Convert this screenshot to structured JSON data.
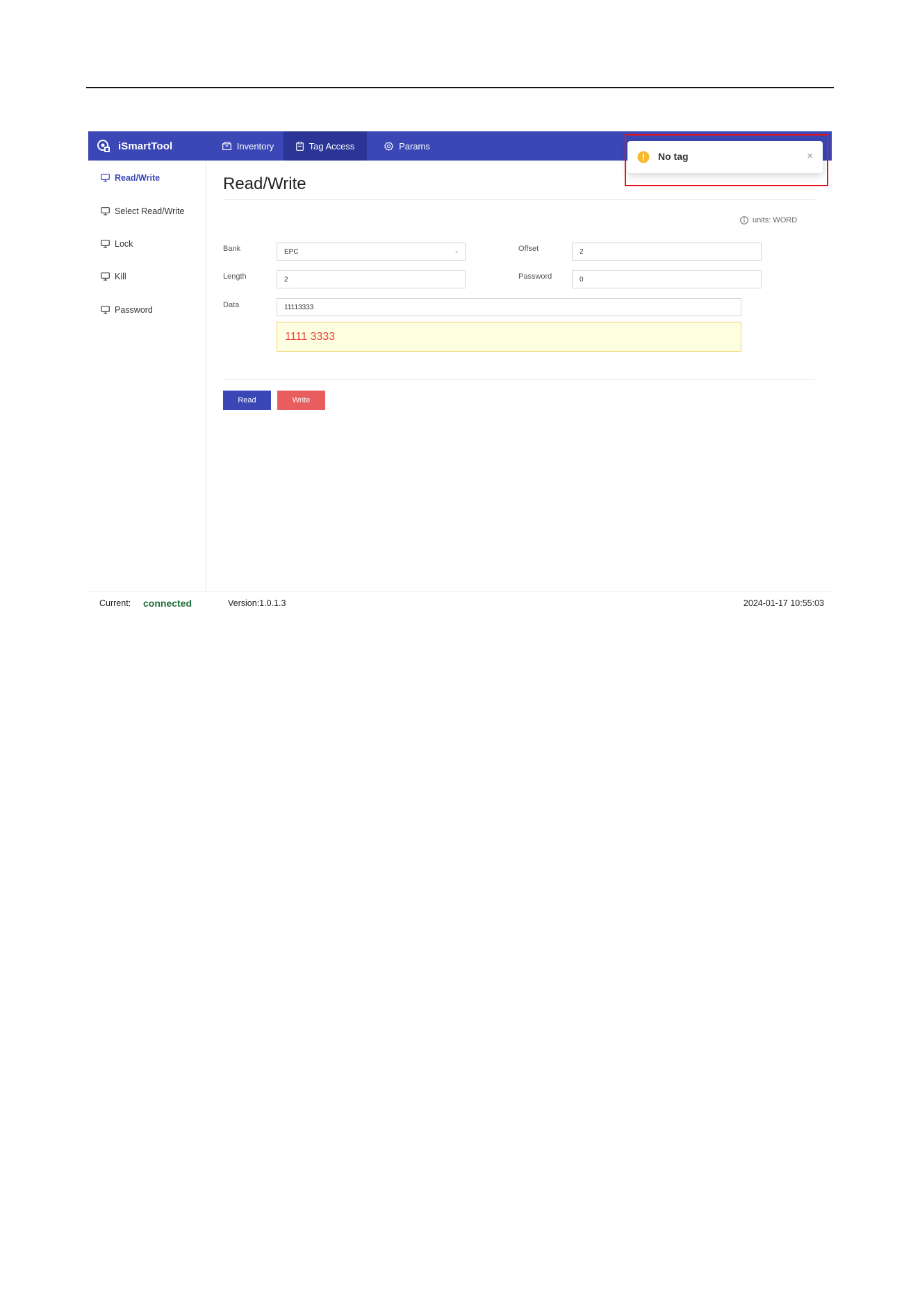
{
  "app": {
    "brand": "iSmartTool",
    "nav": [
      {
        "label": "Inventory",
        "icon": "box-icon",
        "active": false
      },
      {
        "label": "Tag Access",
        "icon": "clipboard-icon",
        "active": true
      },
      {
        "label": "Params",
        "icon": "gear-icon",
        "active": false
      }
    ]
  },
  "sidebar": {
    "items": [
      {
        "label": "Read/Write",
        "icon": "monitor-icon",
        "active": true
      },
      {
        "label": "Select Read/Write",
        "icon": "monitor-icon",
        "active": false
      },
      {
        "label": "Lock",
        "icon": "monitor-icon",
        "active": false
      },
      {
        "label": "Kill",
        "icon": "monitor-icon",
        "active": false
      },
      {
        "label": "Password",
        "icon": "monitor-icon",
        "active": false
      }
    ]
  },
  "main": {
    "title": "Read/Write",
    "units": "units: WORD",
    "form": {
      "bank_label": "Bank",
      "bank_value": "EPC",
      "offset_label": "Offset",
      "offset_value": "2",
      "length_label": "Length",
      "length_value": "2",
      "password_label": "Password",
      "password_value": "0",
      "data_label": "Data",
      "data_value": "11113333",
      "data_preview": "1111 3333"
    },
    "buttons": {
      "read": "Read",
      "write": "Write"
    }
  },
  "footer": {
    "current_label": "Current:",
    "status": "connected",
    "version": "Version:1.0.1.3",
    "datetime": "2024-01-17 10:55:03"
  },
  "notification": {
    "message": "No tag",
    "close": "×"
  },
  "colors": {
    "header": "#3a47b5",
    "header_active": "#2a3595",
    "write_button": "#e85d5d",
    "status_connected": "#1d6e37",
    "preview_text": "#e8423d",
    "warning": "#f5b82e",
    "highlight": "#e8141b"
  }
}
